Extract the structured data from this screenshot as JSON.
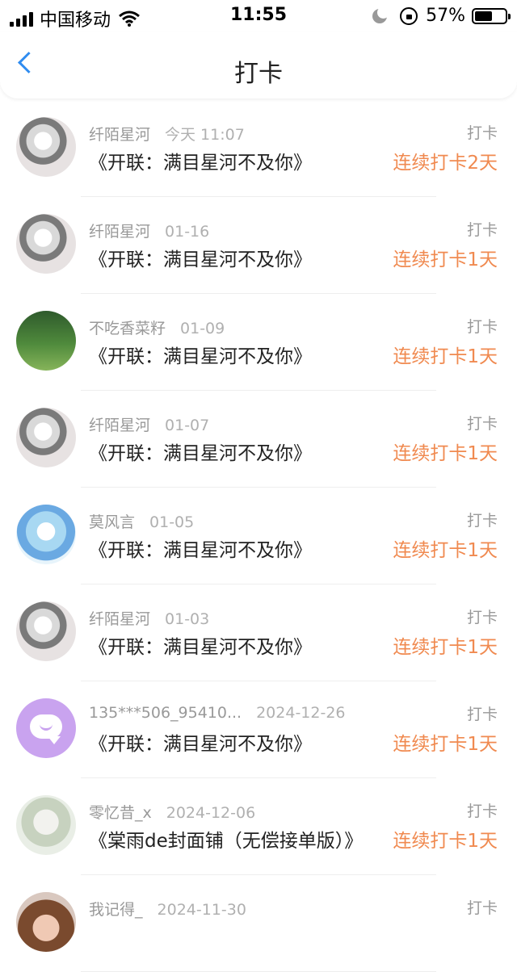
{
  "status_bar": {
    "carrier": "中国移动",
    "time": "11:55",
    "battery": "57%",
    "battery_level": 0.57
  },
  "header": {
    "title": "打卡",
    "back_icon": "chevron-left-icon",
    "accent": "#2f8cf0"
  },
  "colors": {
    "streak": "#f08a50",
    "meta": "#999999"
  },
  "rows": [
    {
      "user": "纤陌星河",
      "date": "今天 11:07",
      "title": "《开联：满目星河不及你》",
      "tag": "打卡",
      "streak": "连续打卡2天"
    },
    {
      "user": "纤陌星河",
      "date": "01-16",
      "title": "《开联：满目星河不及你》",
      "tag": "打卡",
      "streak": "连续打卡1天"
    },
    {
      "user": "不吃香菜籽",
      "date": "01-09",
      "title": "《开联：满目星河不及你》",
      "tag": "打卡",
      "streak": "连续打卡1天"
    },
    {
      "user": "纤陌星河",
      "date": "01-07",
      "title": "《开联：满目星河不及你》",
      "tag": "打卡",
      "streak": "连续打卡1天"
    },
    {
      "user": "莫风言",
      "date": "01-05",
      "title": "《开联：满目星河不及你》",
      "tag": "打卡",
      "streak": "连续打卡1天"
    },
    {
      "user": "纤陌星河",
      "date": "01-03",
      "title": "《开联：满目星河不及你》",
      "tag": "打卡",
      "streak": "连续打卡1天"
    },
    {
      "user": "135***506_95410...",
      "date": "2024-12-26",
      "title": "《开联：满目星河不及你》",
      "tag": "打卡",
      "streak": "连续打卡1天"
    },
    {
      "user": "零忆昔_x",
      "date": "2024-12-06",
      "title": "《棠雨de封面铺（无偿接单版）》",
      "tag": "打卡",
      "streak": "连续打卡1天"
    },
    {
      "user": "我记得_",
      "date": "2024-11-30",
      "title": "",
      "tag": "打卡",
      "streak": ""
    }
  ]
}
